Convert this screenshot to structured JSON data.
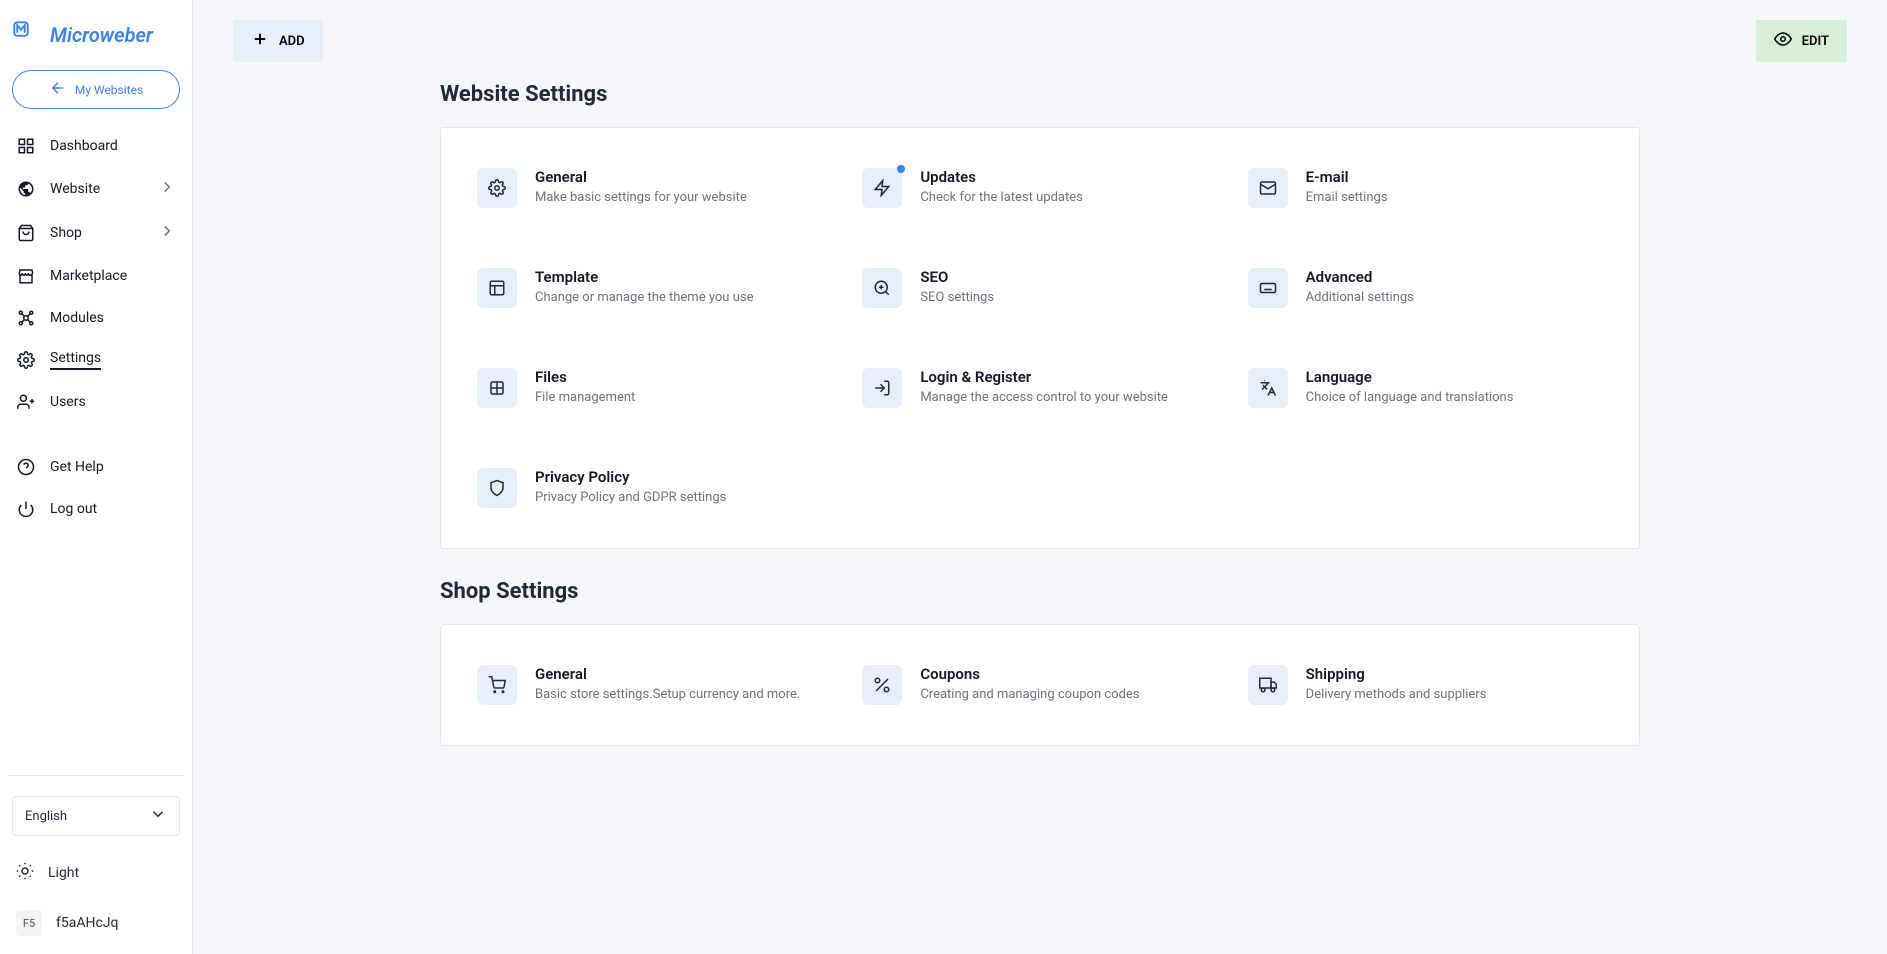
{
  "logo": {
    "text": "Microweber"
  },
  "myWebsitesBtn": "My Websites",
  "sidebar": {
    "items": [
      {
        "label": "Dashboard",
        "icon": "dashboard",
        "chevron": false
      },
      {
        "label": "Website",
        "icon": "globe",
        "chevron": true
      },
      {
        "label": "Shop",
        "icon": "bag",
        "chevron": true
      },
      {
        "label": "Marketplace",
        "icon": "store",
        "chevron": false
      },
      {
        "label": "Modules",
        "icon": "modules",
        "chevron": false
      },
      {
        "label": "Settings",
        "icon": "gear",
        "chevron": false,
        "active": true
      },
      {
        "label": "Users",
        "icon": "users",
        "chevron": false
      }
    ],
    "bottom": [
      {
        "label": "Get Help",
        "icon": "help"
      },
      {
        "label": "Log out",
        "icon": "power"
      }
    ],
    "langSelect": "English",
    "theme": "Light",
    "user": {
      "avatarText": "F5",
      "name": "f5aAHcJq"
    }
  },
  "topbar": {
    "addLabel": "ADD",
    "editLabel": "EDIT"
  },
  "sections": [
    {
      "title": "Website Settings",
      "tiles": [
        {
          "title": "General",
          "desc": "Make basic settings for your website",
          "icon": "gear",
          "notif": false
        },
        {
          "title": "Updates",
          "desc": "Check for the latest updates",
          "icon": "bolt",
          "notif": true
        },
        {
          "title": "E-mail",
          "desc": "Email settings",
          "icon": "mail",
          "notif": false
        },
        {
          "title": "Template",
          "desc": "Change or manage the theme you use",
          "icon": "template",
          "notif": false
        },
        {
          "title": "SEO",
          "desc": "SEO settings",
          "icon": "seo",
          "notif": false
        },
        {
          "title": "Advanced",
          "desc": "Additional settings",
          "icon": "keyboard",
          "notif": false
        },
        {
          "title": "Files",
          "desc": "File management",
          "icon": "files",
          "notif": false
        },
        {
          "title": "Login & Register",
          "desc": "Manage the access control to your website",
          "icon": "login",
          "notif": false
        },
        {
          "title": "Language",
          "desc": "Choice of language and translations",
          "icon": "lang",
          "notif": false
        },
        {
          "title": "Privacy Policy",
          "desc": "Privacy Policy and GDPR settings",
          "icon": "shield",
          "notif": false
        }
      ]
    },
    {
      "title": "Shop Settings",
      "tiles": [
        {
          "title": "General",
          "desc": "Basic store settings.Setup currency and more.",
          "icon": "cart",
          "notif": false
        },
        {
          "title": "Coupons",
          "desc": "Creating and managing coupon codes",
          "icon": "coupon",
          "notif": false
        },
        {
          "title": "Shipping",
          "desc": "Delivery methods and suppliers",
          "icon": "truck",
          "notif": false
        }
      ]
    }
  ]
}
